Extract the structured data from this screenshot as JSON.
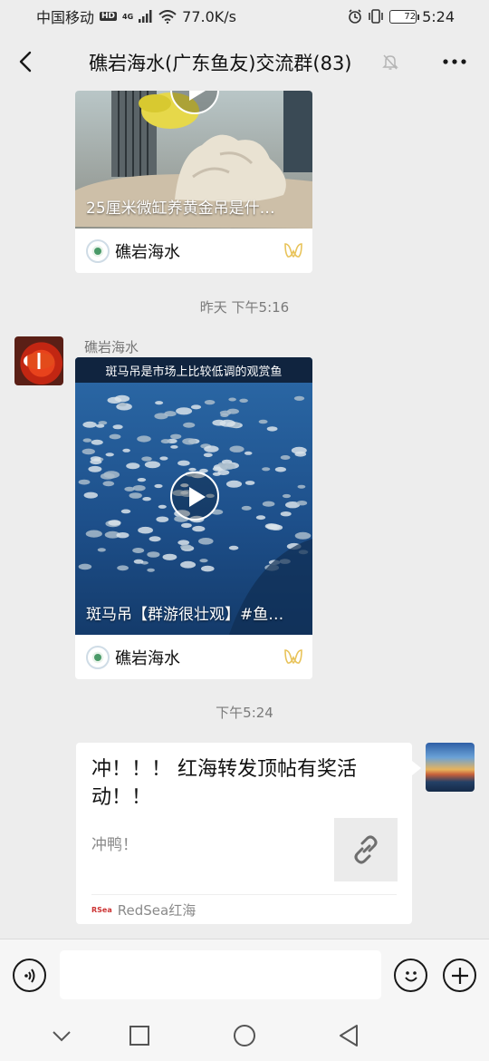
{
  "status_bar": {
    "carrier": "中国移动",
    "hd": "HD",
    "net_type": "4G",
    "speed": "77.0K/s",
    "battery": "72",
    "time": "5:24"
  },
  "header": {
    "title": "礁岩海水(广东鱼友)交流群(83)"
  },
  "messages": {
    "video1": {
      "caption": "25厘米微缸养黄金吊是什…",
      "channel": "礁岩海水"
    },
    "time1": "昨天 下午5:16",
    "sender": "礁岩海水",
    "video2": {
      "banner": "斑马吊是市场上比较低调的观赏鱼",
      "caption": "斑马吊【群游很壮观】#鱼…",
      "channel": "礁岩海水"
    },
    "time2": "下午5:24",
    "link": {
      "title": "冲！！！ 红海转发顶帖有奖活动！！",
      "desc": "冲鸭！",
      "source": "RedSea红海",
      "source_logo": "RSea"
    }
  },
  "input": {
    "placeholder": ""
  },
  "icons": {
    "back": "back-arrow-icon",
    "mute": "mute-bell-icon",
    "more": "more-dots-icon",
    "voice": "voice-icon",
    "emoji": "emoji-icon",
    "plus": "plus-icon",
    "link": "link-icon",
    "channels": "channels-icon"
  },
  "colors": {
    "background": "#ededed",
    "channel_accent": "#e8c35a"
  }
}
